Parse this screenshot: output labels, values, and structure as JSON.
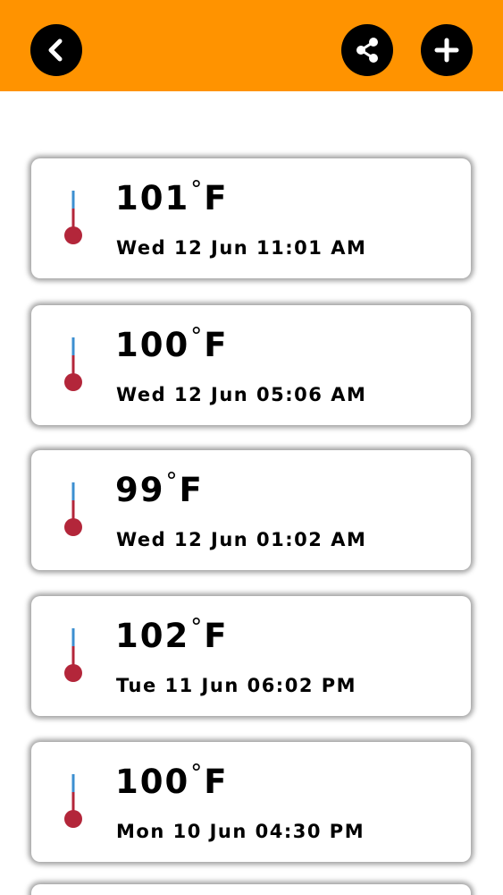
{
  "header": {
    "background": "#ff9300",
    "back_icon": "chevron-left-icon",
    "share_icon": "share-icon",
    "add_icon": "plus-icon"
  },
  "readings": [
    {
      "value": "101",
      "degree": "°",
      "unit": "F",
      "date": "Wed 12 Jun 11:01 AM"
    },
    {
      "value": "100",
      "degree": "°",
      "unit": "F",
      "date": "Wed 12 Jun 05:06 AM"
    },
    {
      "value": "99",
      "degree": "°",
      "unit": "F",
      "date": "Wed 12 Jun 01:02 AM"
    },
    {
      "value": "102",
      "degree": "°",
      "unit": "F",
      "date": "Tue 11 Jun 06:02 PM"
    },
    {
      "value": "100",
      "degree": "°",
      "unit": "F",
      "date": "Mon 10 Jun 04:30 PM"
    }
  ],
  "colors": {
    "thermometer_bulb": "#b3263a",
    "thermometer_top": "#3c8fd0"
  }
}
